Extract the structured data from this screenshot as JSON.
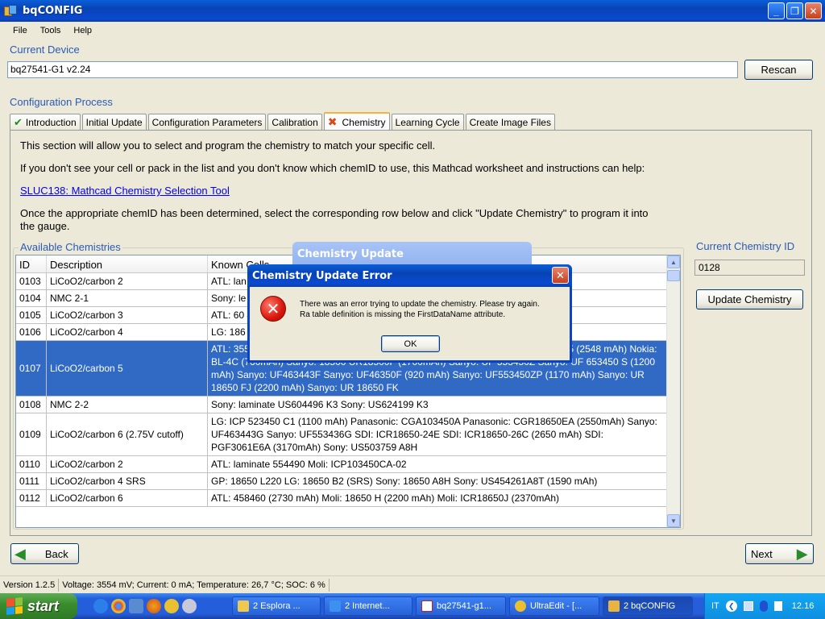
{
  "window": {
    "title": "bqCONFIG",
    "buttons": [
      "_",
      "❐",
      "✕"
    ]
  },
  "menu": [
    "File",
    "Tools",
    "Help"
  ],
  "current_device": {
    "label": "Current Device",
    "value": "bq27541-G1 v2.24",
    "rescan_label": "Rescan"
  },
  "config": {
    "label": "Configuration Process",
    "tabs": [
      {
        "label": "Introduction",
        "icon": "check-icon"
      },
      {
        "label": "Initial Update"
      },
      {
        "label": "Configuration Parameters"
      },
      {
        "label": "Calibration"
      },
      {
        "label": "Chemistry",
        "icon": "x-icon",
        "active": true
      },
      {
        "label": "Learning Cycle"
      },
      {
        "label": "Create Image Files"
      }
    ]
  },
  "chemistry": {
    "intro": "This section will allow you to select and program the chemistry to match your specific cell.",
    "help": "If you don't see your cell or pack in the list and you don't know which chemID to use, this Mathcad worksheet and instructions can help:",
    "link": "SLUC138: Mathcad Chemistry Selection Tool",
    "instructions": "Once the appropriate chemID has been determined, select the corresponding row below and click \"Update Chemistry\" to program it into the gauge.",
    "available_label": "Available Chemistries",
    "columns": [
      "ID",
      "Description",
      "Known Cells"
    ],
    "rows": [
      {
        "id": "0103",
        "desc": "LiCoO2/carbon 2",
        "known": "ATL: lan"
      },
      {
        "id": "0104",
        "desc": "NMC 2-1",
        "known": "Sony: le"
      },
      {
        "id": "0105",
        "desc": "LiCoO2/carbon 3",
        "known": "ATL: 60                                                                                                        41PV (630mAh) Korea F                                                                                                                    0P   SDI: ICR1865"
      },
      {
        "id": "0106",
        "desc": "LiCoO2/carbon 4",
        "known": "LG: 186"
      },
      {
        "id": "0107",
        "desc": "LiCoO2/carbon 5",
        "known": "ATL: 3558120 (2780 mAh)   ATL: 454259   ATL: 466371 - K36 (2315 mAh)   ATL: 467665 (2548 mAh)   Nokia: BL-4C (760mAh)   Sanyo: 18500 UR18500F (1700mAh)   Sanyo: UF 553450Z   Sanyo: UF 653450 S (1200 mAh)   Sanyo: UF463443F   Sanyo: UF46350F (920 mAh)   Sanyo: UF553450ZP (1170 mAh)   Sanyo: UR 18650 FJ (2200 mAh)   Sanyo: UR 18650 FK",
        "selected": true
      },
      {
        "id": "0108",
        "desc": "NMC 2-2",
        "known": "Sony: laminate US604496 K3   Sony: US624199 K3"
      },
      {
        "id": "0109",
        "desc": "LiCoO2/carbon 6 (2.75V cutoff)",
        "known": "LG: ICP 523450 C1 (1100 mAh)   Panasonic: CGA103450A   Panasonic: CGR18650EA (2550mAh)   Sanyo: UF463443G   Sanyo: UF553436G   SDI: ICR18650-24E   SDI: ICR18650-26C (2650 mAh)   SDI: PGF3061E6A (3170mAh)   Sony: US503759 A8H"
      },
      {
        "id": "0110",
        "desc": "LiCoO2/carbon 2",
        "known": "ATL: laminate 554490   Moli: ICP103450CA-02"
      },
      {
        "id": "0111",
        "desc": "LiCoO2/carbon 4 SRS",
        "known": "GP: 18650 L220   LG: 18650 B2 (SRS)   Sony: 18650 A8H   Sony: US454261A8T (1590 mAh)"
      },
      {
        "id": "0112",
        "desc": "LiCoO2/carbon 6",
        "known": "ATL: 458460 (2730 mAh)   Moli: 18650 H (2200 mAh)   Moli: ICR18650J (2370mAh)"
      }
    ],
    "current_id_label": "Current Chemistry ID",
    "current_id": "0128",
    "update_label": "Update Chemistry"
  },
  "nav": {
    "back": "Back",
    "next": "Next"
  },
  "status": {
    "version": "Version 1.2.5",
    "readings": "Voltage: 3554 mV; Current: 0 mA; Temperature: 26,7 °C; SOC: 6 %"
  },
  "dialogs": {
    "behind_title": "Chemistry Update",
    "error_title": "Chemistry Update Error",
    "error_line1": "There was an error trying to update the chemistry. Please try again.",
    "error_line2": "Ra table definition is missing the FirstDataName attribute.",
    "ok_label": "OK"
  },
  "taskbar": {
    "start": "start",
    "tasks": [
      {
        "label": "2 Esplora ...",
        "icon": "folder-icon"
      },
      {
        "label": "2 Internet...",
        "icon": "ie-icon"
      },
      {
        "label": "bq27541-g1...",
        "icon": "pdf-icon"
      },
      {
        "label": "UltraEdit - [...",
        "icon": "ultraedit-icon"
      },
      {
        "label": "2 bqCONFIG",
        "icon": "bqconfig-icon",
        "active": true
      }
    ],
    "lang": "IT",
    "clock": "12.16"
  }
}
